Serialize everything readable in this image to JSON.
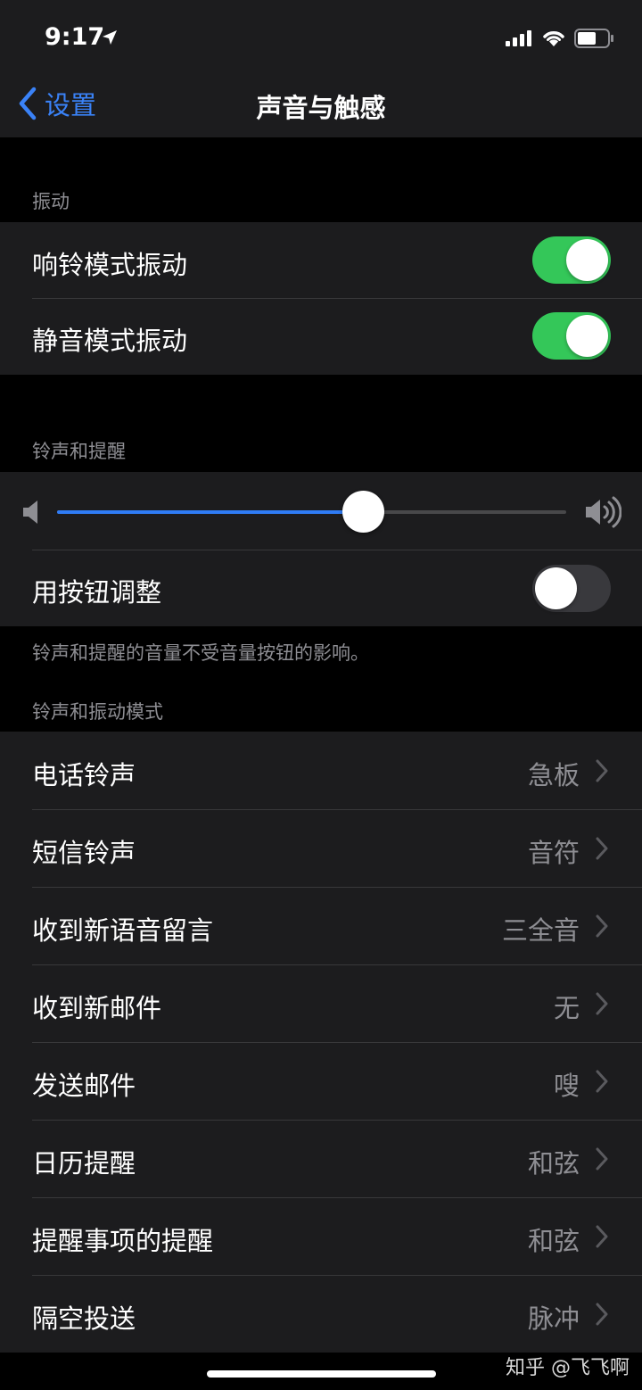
{
  "status": {
    "time": "9:17"
  },
  "nav": {
    "back_label": "设置",
    "title": "声音与触感"
  },
  "vibration": {
    "header": "振动",
    "rows": [
      {
        "label": "响铃模式振动",
        "toggle": true
      },
      {
        "label": "静音模式振动",
        "toggle": true
      }
    ]
  },
  "ringer": {
    "header": "铃声和提醒",
    "volume_level": 0.6,
    "adjust_label": "用按钮调整",
    "adjust_toggle": false,
    "footer": "铃声和提醒的音量不受音量按钮的影响。"
  },
  "patterns": {
    "header": "铃声和振动模式",
    "rows": [
      {
        "label": "电话铃声",
        "value": "急板"
      },
      {
        "label": "短信铃声",
        "value": "音符"
      },
      {
        "label": "收到新语音留言",
        "value": "三全音"
      },
      {
        "label": "收到新邮件",
        "value": "无"
      },
      {
        "label": "发送邮件",
        "value": "嗖"
      },
      {
        "label": "日历提醒",
        "value": "和弦"
      },
      {
        "label": "提醒事项的提醒",
        "value": "和弦"
      },
      {
        "label": "隔空投送",
        "value": "脉冲"
      }
    ]
  },
  "watermark": "知乎 @飞飞啊",
  "colors": {
    "accent": "#3a82f7",
    "toggle_on": "#34c759",
    "slider_fill": "#2f7cf6"
  }
}
